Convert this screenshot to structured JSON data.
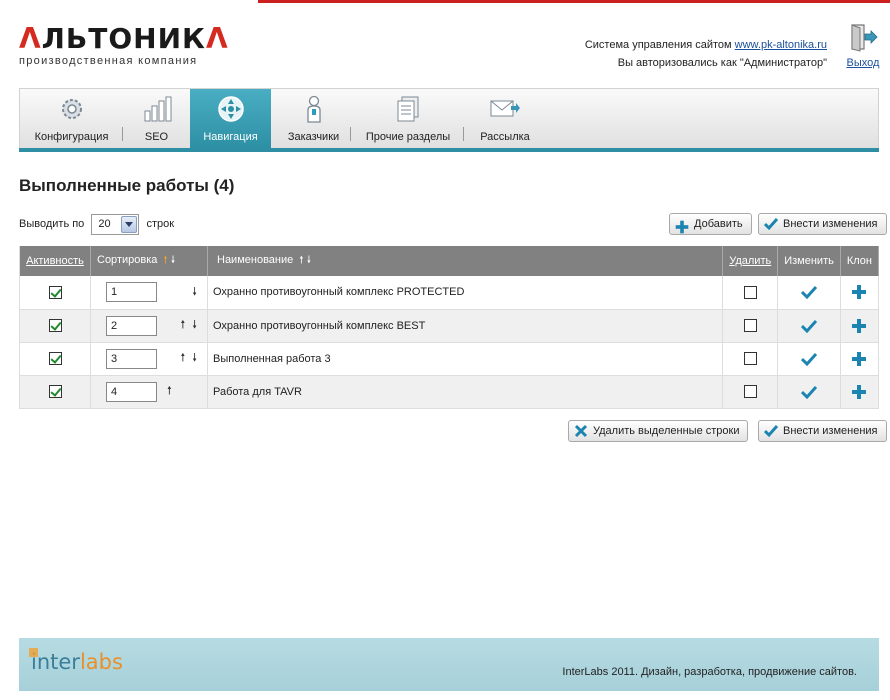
{
  "header": {
    "brand_mark_left": "Λ",
    "brand_text": "ЛЬТОНИК",
    "brand_mark_right": "Λ",
    "tagline": "производственная компания",
    "cms_text": "Система управления сайтом",
    "site_link": "www.pk-altonika.ru",
    "auth_text": "Вы авторизовались как \"Администратор\"",
    "exit_label": "Выход"
  },
  "tabs": [
    {
      "label": "Конфигурация",
      "icon": "gear-icon"
    },
    {
      "label": "SEO",
      "icon": "bar-chart-icon"
    },
    {
      "label": "Навигация",
      "icon": "navigation-icon",
      "active": true
    },
    {
      "label": "Заказчики",
      "icon": "person-icon"
    },
    {
      "label": "Прочие разделы",
      "icon": "documents-icon"
    },
    {
      "label": "Рассылка",
      "icon": "mail-icon"
    }
  ],
  "page": {
    "title": "Выполненные работы (4)",
    "perpage_prefix": "Выводить по",
    "perpage_value": "20",
    "perpage_suffix": "строк",
    "add_label": "Добавить",
    "apply_label": "Внести изменения",
    "delete_selected_label": "Удалить выделенные строки"
  },
  "table": {
    "headers": {
      "active": "Активность",
      "sort": "Сортировка",
      "name": "Наименование",
      "delete": "Удалить",
      "edit": "Изменить",
      "clone": "Клон"
    },
    "rows": [
      {
        "active": true,
        "sort": "1",
        "name": "Охранно противоугонный комплекс PROTECTED",
        "up": false,
        "down": true
      },
      {
        "active": true,
        "sort": "2",
        "name": "Охранно противоугонный комплекс BEST",
        "up": true,
        "down": true
      },
      {
        "active": true,
        "sort": "3",
        "name": "Выполненная работа 3",
        "up": true,
        "down": true
      },
      {
        "active": true,
        "sort": "4",
        "name": "Работа для TAVR",
        "up": true,
        "down": false
      }
    ]
  },
  "footer": {
    "logo_inter": "inter",
    "logo_labs": "labs",
    "credit": "InterLabs 2011. Дизайн, разработка, продвижение сайтов."
  },
  "colors": {
    "accent": "#2e8ea3",
    "brand_red": "#d42a1f",
    "header_gray": "#818181"
  }
}
